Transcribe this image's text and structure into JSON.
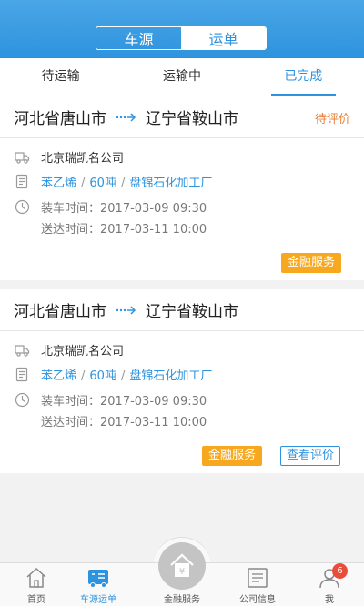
{
  "header": {
    "segments": [
      {
        "label": "车源",
        "active": false
      },
      {
        "label": "运单",
        "active": true
      }
    ]
  },
  "tabs": [
    {
      "label": "待运输",
      "active": false
    },
    {
      "label": "运输中",
      "active": false
    },
    {
      "label": "已完成",
      "active": true
    }
  ],
  "orders": [
    {
      "from": "河北省唐山市",
      "to": "辽宁省鞍山市",
      "status": "待评价",
      "company": "北京瑞凯名公司",
      "cargo": "苯乙烯",
      "weight": "60吨",
      "destination": "盘锦石化加工厂",
      "load_time": "装车时间：2017-03-09  09:30",
      "arrive_time": "送达时间：2017-03-11  10:00",
      "buttons": [
        "金融服务"
      ]
    },
    {
      "from": "河北省唐山市",
      "to": "辽宁省鞍山市",
      "status": "",
      "company": "北京瑞凯名公司",
      "cargo": "苯乙烯",
      "weight": "60吨",
      "destination": "盘锦石化加工厂",
      "load_time": "装车时间：2017-03-09  09:30",
      "arrive_time": "送达时间：2017-03-11  10:00",
      "buttons": [
        "金融服务",
        "查看评价"
      ]
    }
  ],
  "separator": "/",
  "bottom_nav": [
    {
      "label": "首页",
      "icon": "home-icon",
      "active": false
    },
    {
      "label": "车源运单",
      "icon": "truck-icon",
      "active": true
    },
    {
      "label": "金融服务",
      "icon": "finance-icon",
      "active": false
    },
    {
      "label": "公司信息",
      "icon": "company-icon",
      "active": false
    },
    {
      "label": "我",
      "icon": "user-icon",
      "active": false
    }
  ],
  "badge_count": "6",
  "colors": {
    "primary": "#2e93de",
    "accent": "#f7a81f",
    "pending": "#e8803a",
    "badge": "#e84d3c"
  }
}
